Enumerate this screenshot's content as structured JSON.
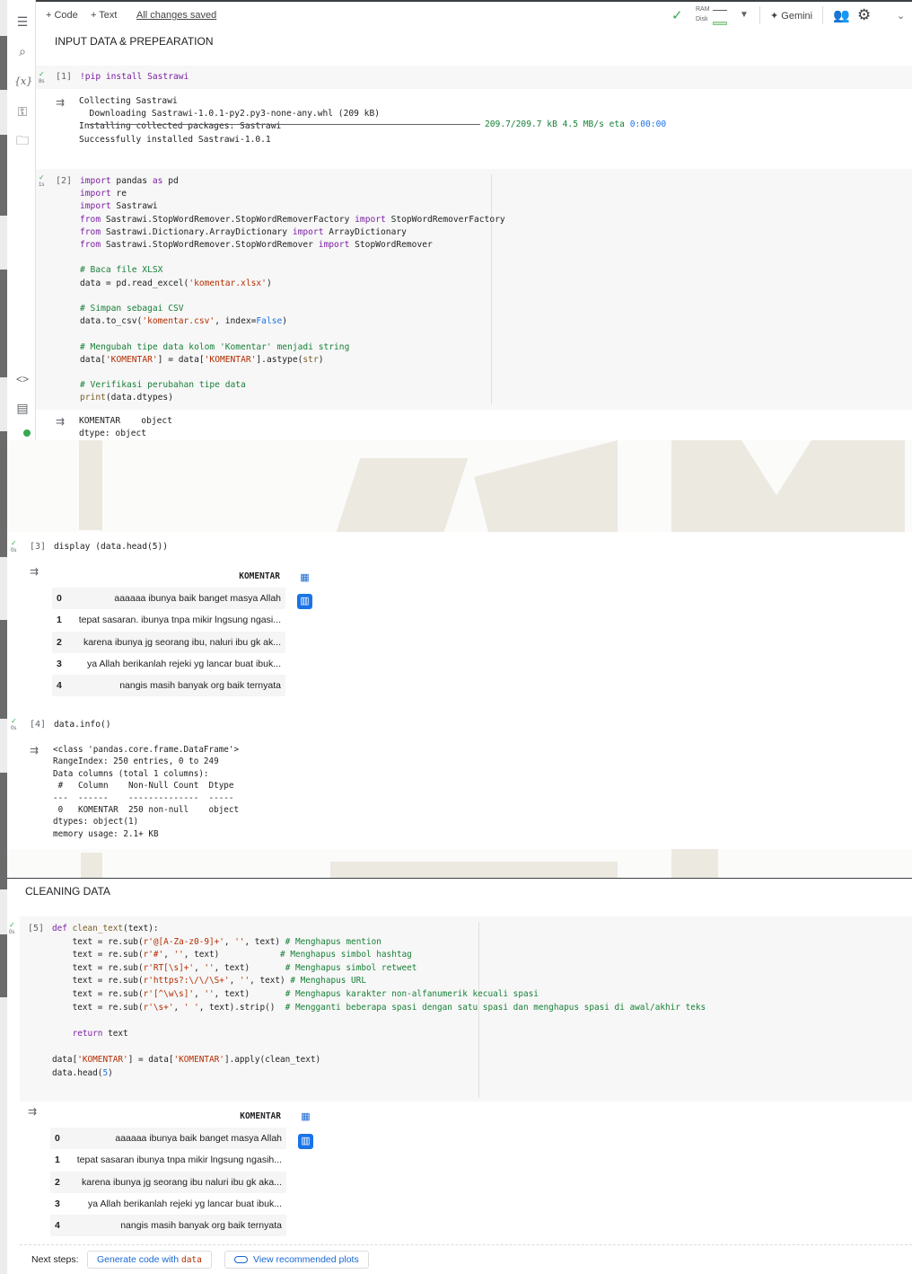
{
  "toolbar": {
    "code_label": "+ Code",
    "text_label": "+ Text",
    "saved_status": "All changes saved",
    "ram_label": "RAM",
    "disk_label": "Disk",
    "gemini_label": "Gemini"
  },
  "sidebar": {
    "icons": [
      "table-of-contents-icon",
      "search-icon",
      "variables-icon",
      "key-icon",
      "folder-icon",
      "code-snippets-icon",
      "command-palette-icon",
      "status-dot-icon"
    ],
    "variables_glyph": "{x}"
  },
  "sections": {
    "input_heading": "INPUT DATA & PREPEARATION",
    "cleaning_heading": "CLEANING DATA"
  },
  "cells": {
    "c1": {
      "prompt": "[1]",
      "time": "8s",
      "code": "!pip install Sastrawi",
      "output_lines": [
        "Collecting Sastrawi",
        "  Downloading Sastrawi-1.0.1-py2.py3-none-any.whl (209 kB)",
        "",
        "Installing collected packages: Sastrawi",
        "Successfully installed Sastrawi-1.0.1"
      ],
      "progress_text": "209.7/209.7 kB 4.5 MB/s eta",
      "progress_eta": "0:00:00"
    },
    "c2": {
      "prompt": "[2]",
      "time": "1s",
      "output_lines": [
        "KOMENTAR    object",
        "dtype: object"
      ]
    },
    "c3": {
      "prompt": "[3]",
      "time": "0s",
      "code": "display (data.head(5))",
      "table_header": "KOMENTAR",
      "rows": [
        {
          "idx": "0",
          "val": "aaaaaa ibunya baik banget masya Allah"
        },
        {
          "idx": "1",
          "val": "tepat sasaran. ibunya tnpa mikir lngsung ngasi..."
        },
        {
          "idx": "2",
          "val": "karena ibunya jg seorang ibu, naluri ibu gk ak..."
        },
        {
          "idx": "3",
          "val": "ya Allah berikanlah rejeki yg lancar buat ibuk..."
        },
        {
          "idx": "4",
          "val": "nangis masih banyak org baik ternyata"
        }
      ]
    },
    "c4": {
      "prompt": "[4]",
      "time": "0s",
      "code": "data.info()",
      "output_lines": [
        "<class 'pandas.core.frame.DataFrame'>",
        "RangeIndex: 250 entries, 0 to 249",
        "Data columns (total 1 columns):",
        " #   Column    Non-Null Count  Dtype ",
        "---  ------    --------------  ----- ",
        " 0   KOMENTAR  250 non-null    object",
        "dtypes: object(1)",
        "memory usage: 2.1+ KB"
      ]
    },
    "c5": {
      "prompt": "[5]",
      "time": "0s",
      "table_header": "KOMENTAR",
      "rows": [
        {
          "idx": "0",
          "val": "aaaaaa ibunya baik banget masya Allah"
        },
        {
          "idx": "1",
          "val": "tepat sasaran ibunya tnpa mikir lngsung ngasih..."
        },
        {
          "idx": "2",
          "val": "karena ibunya jg seorang ibu naluri ibu gk aka..."
        },
        {
          "idx": "3",
          "val": "ya Allah berikanlah rejeki yg lancar buat ibuk..."
        },
        {
          "idx": "4",
          "val": "nangis masih banyak org baik ternyata"
        }
      ]
    }
  },
  "next_steps": {
    "label": "Next steps:",
    "generate_prefix": "Generate code with",
    "generate_var": "data",
    "plots_label": "View recommended plots"
  },
  "colors": {
    "accent": "#1a73e8",
    "ok_green": "#34a853",
    "keyword": "#7b1fa2",
    "string": "#b32d00",
    "comment": "#188038"
  }
}
